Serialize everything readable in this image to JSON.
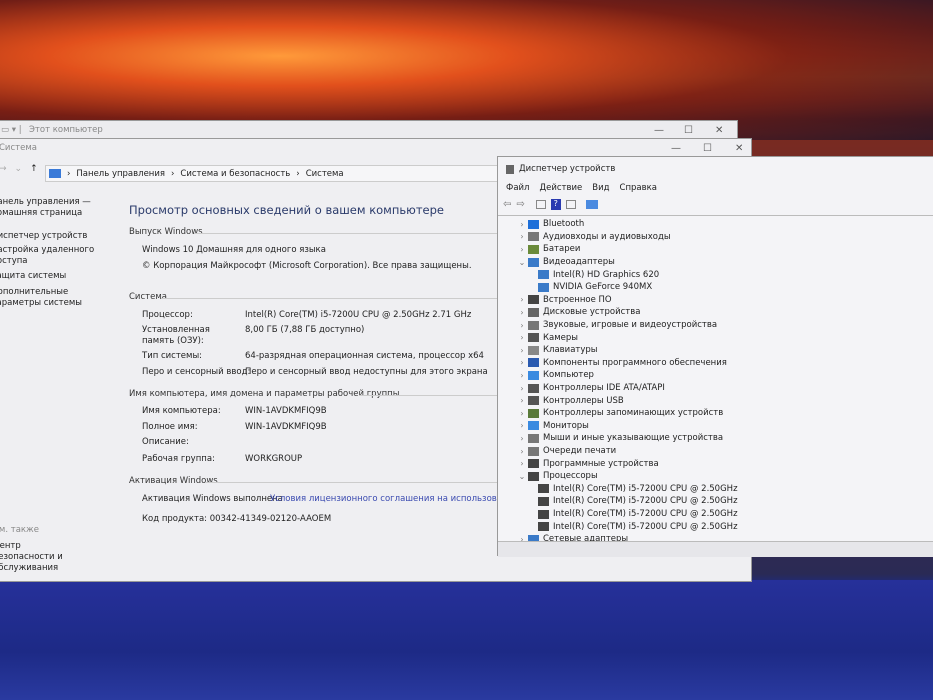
{
  "back_window": {
    "title": "Этот компьютер"
  },
  "control_panel": {
    "title": "Система",
    "breadcrumb": [
      "Панель управления",
      "Система и безопасность",
      "Система"
    ],
    "sidebar": [
      "Панель управления — домашняя страница",
      "Диспетчер устройств",
      "Настройка удаленного доступа",
      "Защита системы",
      "Дополнительные параметры системы"
    ],
    "see_also": "См. также",
    "see_also_items": [
      "Центр безопасности и обслуживания"
    ],
    "page_title": "Просмотр основных сведений о вашем компьютере",
    "edition_header": "Выпуск Windows",
    "edition": "Windows 10 Домашняя для одного языка",
    "copyright": "© Корпорация Майкрософт (Microsoft Corporation). Все права защищены.",
    "system_header": "Система",
    "system_rows": [
      {
        "label": "Процессор:",
        "value": "Intel(R) Core(TM) i5-7200U CPU @ 2.50GHz   2.71 GHz"
      },
      {
        "label": "Установленная память (ОЗУ):",
        "value": "8,00 ГБ (7,88 ГБ доступно)"
      },
      {
        "label": "Тип системы:",
        "value": "64-разрядная операционная система, процессор x64"
      },
      {
        "label": "Перо и сенсорный ввод:",
        "value": "Перо и сенсорный ввод недоступны для этого экрана"
      }
    ],
    "name_header": "Имя компьютера, имя домена и параметры рабочей группы",
    "name_rows": [
      {
        "label": "Имя компьютера:",
        "value": "WIN-1AVDKMFIQ9B"
      },
      {
        "label": "Полное имя:",
        "value": "WIN-1AVDKMFIQ9B"
      },
      {
        "label": "Описание:",
        "value": ""
      },
      {
        "label": "Рабочая группа:",
        "value": "WORKGROUP"
      }
    ],
    "activation_header": "Активация Windows",
    "activation_status": "Активация Windows выполнена",
    "license_link": "Условия лицензионного соглашения на использование пр",
    "product_key": "Код продукта: 00342-41349-02120-AAOEM"
  },
  "device_manager": {
    "title": "Диспетчер устройств",
    "menu": [
      "Файл",
      "Действие",
      "Вид",
      "Справка"
    ],
    "tree": [
      {
        "label": "Bluetooth",
        "level": 0,
        "expanded": false,
        "color": "#1e6fd9"
      },
      {
        "label": "Аудиовходы и аудиовыходы",
        "level": 0,
        "expanded": false,
        "color": "#777"
      },
      {
        "label": "Батареи",
        "level": 0,
        "expanded": false,
        "color": "#6a8a3a"
      },
      {
        "label": "Видеоадаптеры",
        "level": 0,
        "expanded": true,
        "color": "#3a7ac8"
      },
      {
        "label": "Intel(R) HD Graphics 620",
        "level": 1,
        "color": "#3a7ac8"
      },
      {
        "label": "NVIDIA GeForce 940MX",
        "level": 1,
        "color": "#3a7ac8"
      },
      {
        "label": "Встроенное ПО",
        "level": 0,
        "expanded": false,
        "color": "#444"
      },
      {
        "label": "Дисковые устройства",
        "level": 0,
        "expanded": false,
        "color": "#666"
      },
      {
        "label": "Звуковые, игровые и видеоустройства",
        "level": 0,
        "expanded": false,
        "color": "#777"
      },
      {
        "label": "Камеры",
        "level": 0,
        "expanded": false,
        "color": "#555"
      },
      {
        "label": "Клавиатуры",
        "level": 0,
        "expanded": false,
        "color": "#888"
      },
      {
        "label": "Компоненты программного обеспечения",
        "level": 0,
        "expanded": false,
        "color": "#2a5ab0"
      },
      {
        "label": "Компьютер",
        "level": 0,
        "expanded": false,
        "color": "#3a8ae0"
      },
      {
        "label": "Контроллеры IDE ATA/ATAPI",
        "level": 0,
        "expanded": false,
        "color": "#555"
      },
      {
        "label": "Контроллеры USB",
        "level": 0,
        "expanded": false,
        "color": "#555"
      },
      {
        "label": "Контроллеры запоминающих устройств",
        "level": 0,
        "expanded": false,
        "color": "#5a7a3a"
      },
      {
        "label": "Мониторы",
        "level": 0,
        "expanded": false,
        "color": "#3a8ae0"
      },
      {
        "label": "Мыши и иные указывающие устройства",
        "level": 0,
        "expanded": false,
        "color": "#777"
      },
      {
        "label": "Очереди печати",
        "level": 0,
        "expanded": false,
        "color": "#777"
      },
      {
        "label": "Программные устройства",
        "level": 0,
        "expanded": false,
        "color": "#444"
      },
      {
        "label": "Процессоры",
        "level": 0,
        "expanded": true,
        "color": "#444"
      },
      {
        "label": "Intel(R) Core(TM) i5-7200U CPU @ 2.50GHz",
        "level": 1,
        "color": "#444"
      },
      {
        "label": "Intel(R) Core(TM) i5-7200U CPU @ 2.50GHz",
        "level": 1,
        "color": "#444"
      },
      {
        "label": "Intel(R) Core(TM) i5-7200U CPU @ 2.50GHz",
        "level": 1,
        "color": "#444"
      },
      {
        "label": "Intel(R) Core(TM) i5-7200U CPU @ 2.50GHz",
        "level": 1,
        "color": "#444"
      },
      {
        "label": "Сетевые адаптеры",
        "level": 0,
        "expanded": false,
        "color": "#3a7ac8"
      }
    ]
  }
}
